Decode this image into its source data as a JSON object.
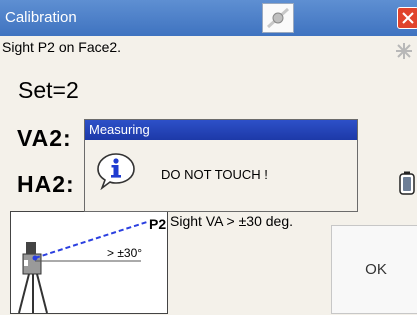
{
  "window": {
    "title": "Calibration",
    "title_icon": "target-prism-icon",
    "close_icon": "close-icon"
  },
  "instruction": "Sight P2 on Face2.",
  "set_label": "Set=2",
  "va_label": "VA2:",
  "ha_label": "HA2:",
  "status_icons": {
    "star": "star-icon",
    "battery": "battery-icon"
  },
  "diagram": {
    "point_label": "P2",
    "angle_label": "> ±30°",
    "caption": "Sight VA > ±30 deg."
  },
  "ok_button": "OK",
  "dialog": {
    "title": "Measuring",
    "message": "DO NOT TOUCH !",
    "icon": "info-icon"
  },
  "colors": {
    "titlebar": "#4a7ecb",
    "dialog_titlebar": "#2444b8",
    "close": "#e0432c"
  }
}
